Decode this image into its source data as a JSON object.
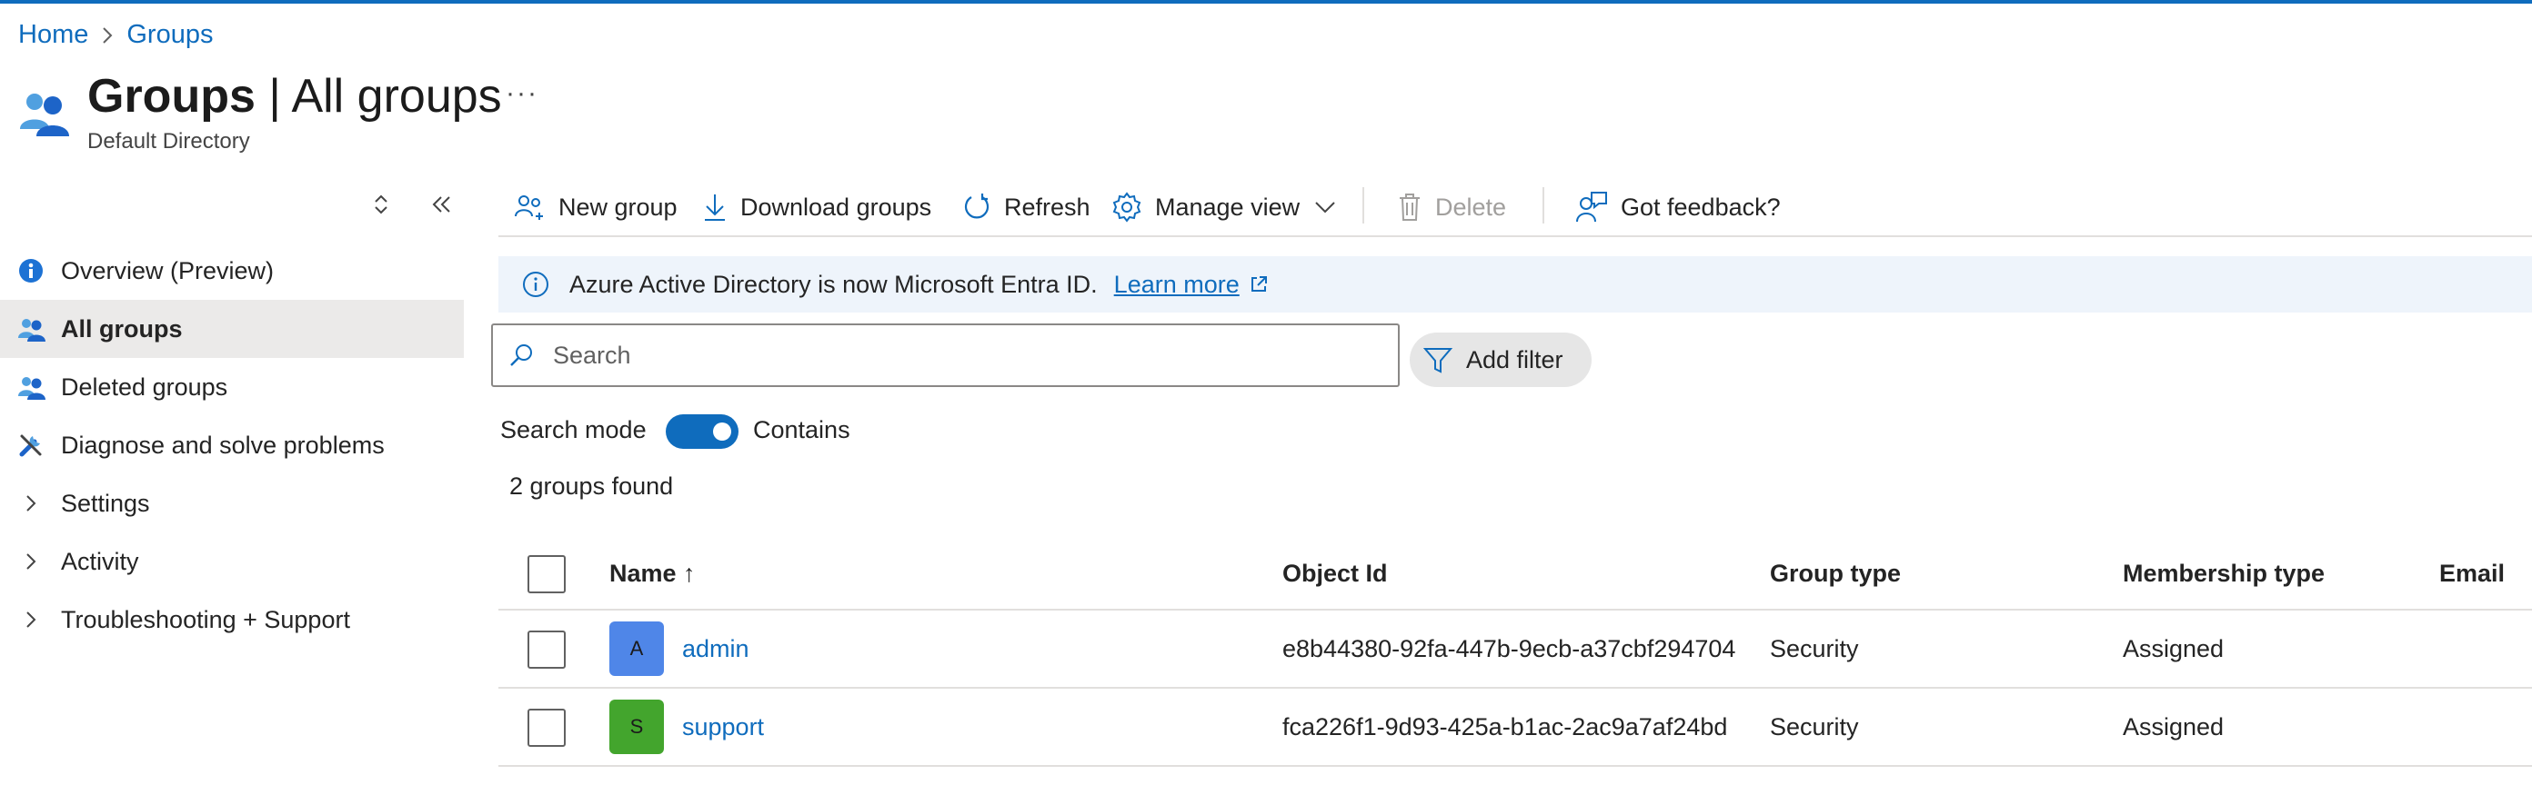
{
  "breadcrumb": {
    "home": "Home",
    "groups": "Groups"
  },
  "header": {
    "title_bold": "Groups",
    "title_rest": " | All groups",
    "subtitle": "Default Directory",
    "more": "···"
  },
  "sidebar": {
    "items": [
      {
        "label": "Overview (Preview)",
        "icon": "info-icon"
      },
      {
        "label": "All groups",
        "icon": "groups-icon",
        "active": true
      },
      {
        "label": "Deleted groups",
        "icon": "groups-icon"
      },
      {
        "label": "Diagnose and solve problems",
        "icon": "wrench-icon"
      },
      {
        "label": "Settings",
        "icon": "chevron-right-icon"
      },
      {
        "label": "Activity",
        "icon": "chevron-right-icon"
      },
      {
        "label": "Troubleshooting + Support",
        "icon": "chevron-right-icon"
      }
    ]
  },
  "toolbar": {
    "new_group": "New group",
    "download_groups": "Download groups",
    "refresh": "Refresh",
    "manage_view": "Manage view",
    "delete": "Delete",
    "feedback": "Got feedback?"
  },
  "banner": {
    "text": "Azure Active Directory is now Microsoft Entra ID.",
    "link": "Learn more"
  },
  "search": {
    "placeholder": "Search",
    "value": "",
    "add_filter": "Add filter",
    "mode_label": "Search mode",
    "mode_value": "Contains",
    "mode_on": true
  },
  "results": {
    "count_text": "2 groups found"
  },
  "table": {
    "columns": {
      "name": "Name ↑",
      "object_id": "Object Id",
      "group_type": "Group type",
      "membership_type": "Membership type",
      "email": "Email"
    },
    "rows": [
      {
        "initial": "A",
        "avatar_color": "#4f86e8",
        "name": "admin",
        "object_id": "e8b44380-92fa-447b-9ecb-a37cbf294704",
        "group_type": "Security",
        "membership_type": "Assigned"
      },
      {
        "initial": "S",
        "avatar_color": "#43a52d",
        "name": "support",
        "object_id": "fca226f1-9d93-425a-b1ac-2ac9a7af24bd",
        "group_type": "Security",
        "membership_type": "Assigned"
      }
    ]
  },
  "colors": {
    "accent": "#0f6cbd",
    "banner_bg": "#eef4fb",
    "active_nav_bg": "#ebeae9"
  }
}
